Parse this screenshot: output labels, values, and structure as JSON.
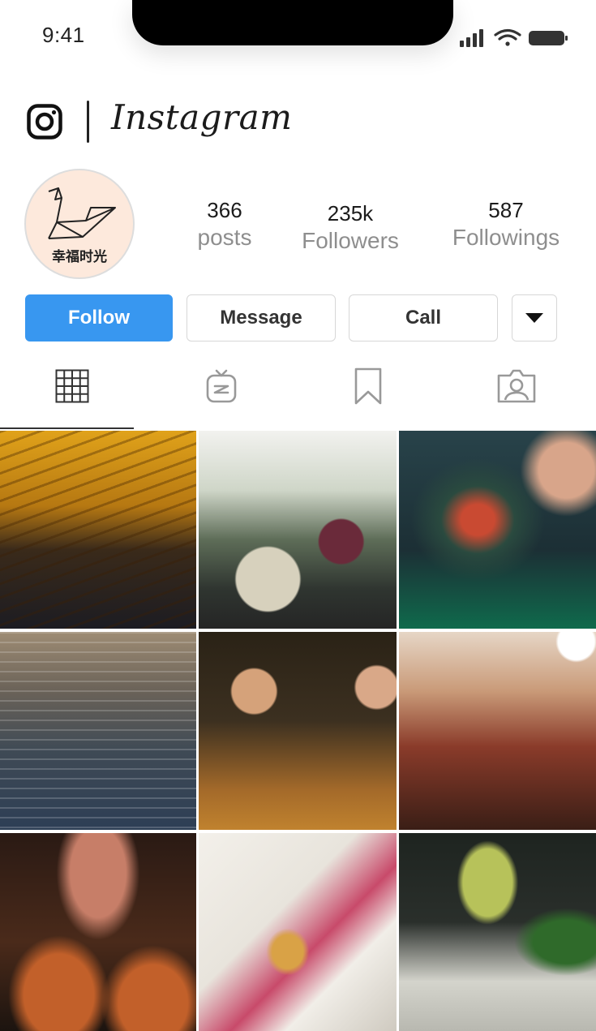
{
  "status_bar": {
    "time": "9:41",
    "icons": [
      "signal-icon",
      "wifi-icon",
      "battery-icon"
    ]
  },
  "header": {
    "logo_icon": "instagram-camera-icon",
    "wordmark": "Instagram"
  },
  "profile": {
    "avatar_text": "幸福时光",
    "stats": [
      {
        "value": "366",
        "label": "posts"
      },
      {
        "value": "235k",
        "label": "Followers"
      },
      {
        "value": "587",
        "label": "Followings"
      }
    ]
  },
  "actions": {
    "follow_label": "Follow",
    "message_label": "Message",
    "call_label": "Call",
    "more_icon": "caret-down-icon"
  },
  "tabs": [
    {
      "icon": "grid-icon",
      "active": true
    },
    {
      "icon": "igtv-icon",
      "active": false
    },
    {
      "icon": "bookmark-icon",
      "active": false
    },
    {
      "icon": "tagged-person-icon",
      "active": false
    }
  ],
  "colors": {
    "accent": "#3897f0",
    "text": "#222222",
    "muted": "#8e8e8e",
    "avatar_bg": "#fde9dc"
  },
  "grid_posts": [
    {
      "subject": "restaurant-interior-pendant-lights"
    },
    {
      "subject": "diners-at-dim-sum-table"
    },
    {
      "subject": "chef-plating-salad"
    },
    {
      "subject": "restaurant-hall-booths"
    },
    {
      "subject": "men-tasting-wine-laptop"
    },
    {
      "subject": "warm-dining-room"
    },
    {
      "subject": "pouring-whisky-glasses"
    },
    {
      "subject": "fortune-cookie-menu"
    },
    {
      "subject": "green-cocktail-coupe"
    }
  ]
}
